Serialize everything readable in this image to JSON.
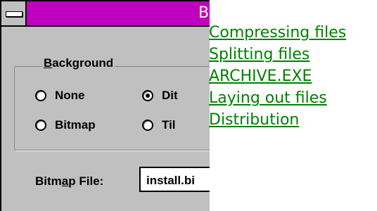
{
  "window": {
    "title_fragment": "B"
  },
  "background_group": {
    "legend_prefix": "",
    "legend_accel": "B",
    "legend_rest": "ackground",
    "options": [
      {
        "label": "None",
        "selected": false
      },
      {
        "label": "Bitmap",
        "selected": false
      },
      {
        "label": "Dit",
        "selected": true
      },
      {
        "label": "Til",
        "selected": false
      }
    ]
  },
  "bitmap_file": {
    "label_start": "Bitm",
    "label_accel": "a",
    "label_end": "p File:",
    "value": "install.bi"
  },
  "topic_links": [
    "Compressing files",
    "Splitting files",
    "ARCHIVE.EXE",
    "Laying out files",
    "Distribution"
  ],
  "colors": {
    "titlebar": "#c000c0",
    "dialog_face": "#c0c0c0",
    "link": "#008000"
  }
}
